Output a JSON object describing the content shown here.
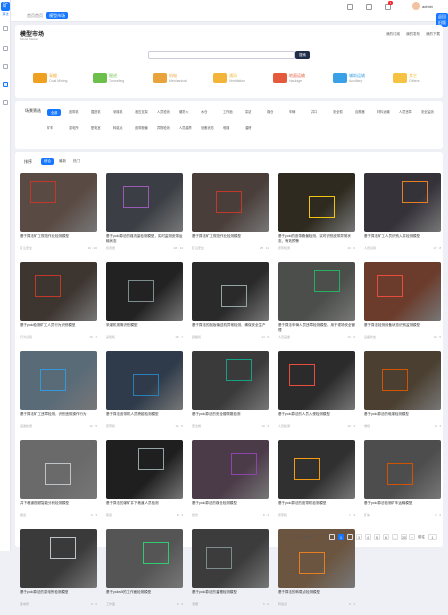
{
  "app": {
    "logo_char": "矿",
    "logo_text": "算法"
  },
  "top": {
    "breadcrumb_home": "首页首页",
    "breadcrumb_current": "模型市场",
    "badge_count": "1",
    "user_name": "admin",
    "mode_label": "返回旧版"
  },
  "page": {
    "title": "模型市场",
    "subtitle": "Model Market",
    "quick_links": [
      "我的订阅",
      "我的发布",
      "我的下载"
    ]
  },
  "search": {
    "placeholder": "",
    "button": "搜索"
  },
  "categories": [
    {
      "name": "采掘",
      "en": "Coal Mining",
      "color": "#f0a020"
    },
    {
      "name": "掘进",
      "en": "Tunneling",
      "color": "#6dbf4b"
    },
    {
      "name": "机电",
      "en": "Mechanical",
      "color": "#e8a33c"
    },
    {
      "name": "通风",
      "en": "Ventilation",
      "color": "#f2b53a"
    },
    {
      "name": "地面运输",
      "en": "Haulage",
      "color": "#e55a3c"
    },
    {
      "name": "辅助运输",
      "en": "Auxiliary",
      "color": "#3aa0e8"
    },
    {
      "name": "其它",
      "en": "Others",
      "color": "#f5c242"
    }
  ],
  "tags": {
    "label": "场景筛选",
    "items": [
      "全部",
      "皮带机",
      "掘进机",
      "采煤机",
      "液压支架",
      "人员检测",
      "烟雾火",
      "水仓",
      "工作面",
      "泵站",
      "煤仓",
      "车辆",
      "井口",
      "安全帽",
      "自救器",
      "材料运输",
      "人员违章",
      "安全监测",
      "矿车",
      "变电所",
      "配电室",
      "转载点",
      "皮带跑偏",
      "异物检测",
      "人员越界",
      "设备状态",
      "堆煤",
      "溜槽"
    ]
  },
  "sort": {
    "label": "排序",
    "items": [
      "综合",
      "最新",
      "热门"
    ]
  },
  "models": [
    {
      "caption": "基于算法矿工规范作业检测模型",
      "meta_l": "矿山安全",
      "meta_r": "32 · 20"
    },
    {
      "caption": "基于yolo算法的煤流量检测模型，实时监测皮带运输状态",
      "meta_l": "煤流量",
      "meta_r": "28 · 14"
    },
    {
      "caption": "基于算法矿工规范作业检测模型",
      "meta_l": "矿山安全",
      "meta_r": "25 · 11"
    },
    {
      "caption": "基于yolo的皮带跑偏检测，实时识别皮带异常状态，有效预警",
      "meta_l": "皮带检测",
      "meta_r": "19 · 9"
    },
    {
      "caption": "基于算法矿工人员识别入井检测模型",
      "meta_l": "人员识别",
      "meta_r": "17 · 8"
    },
    {
      "caption": "基于yolo检测矿工人员行为识别模型",
      "meta_l": "行为识别",
      "meta_r": "16 · 7"
    },
    {
      "caption": "采煤机滚筒识别模型",
      "meta_l": "采煤机",
      "meta_r": "15 · 7"
    },
    {
      "caption": "基于算法的刮板输送机异常检测，确保安全生产",
      "meta_l": "刮板机",
      "meta_r": "14 · 6"
    },
    {
      "caption": "基于算法车辆人员违章检测模型，用于现场安全管理",
      "meta_l": "人员违章",
      "meta_r": "13 · 6"
    },
    {
      "caption": "基于算法检测设备状态识别监测模型",
      "meta_l": "设备状态",
      "meta_r": "12 · 5"
    },
    {
      "caption": "基于算法矿工违章检测，识别违规操作行为",
      "meta_l": "违章检测",
      "meta_r": "12 · 5"
    },
    {
      "caption": "基于算法皮带机人员跨越检测模型",
      "meta_l": "皮带机",
      "meta_r": "11 · 5"
    },
    {
      "caption": "基于yolo算法的安全帽佩戴检测",
      "meta_l": "安全帽",
      "meta_r": "10 · 4"
    },
    {
      "caption": "基于yolo算法的人员入侵检测模型",
      "meta_l": "人员检测",
      "meta_r": "10 · 4"
    },
    {
      "caption": "基于yolo算法的堆煤检测模型",
      "meta_l": "堆煤",
      "meta_r": "9 · 4"
    },
    {
      "caption": "井下巷道视频智能分析检测模型",
      "meta_l": "巷道",
      "meta_r": "9 · 3"
    },
    {
      "caption": "基于算法的煤矿井下巷道人员检测",
      "meta_l": "巷道",
      "meta_r": "8 · 3"
    },
    {
      "caption": "基于yolo算法的煤仓检测模型",
      "meta_l": "煤仓",
      "meta_r": "8 · 3"
    },
    {
      "caption": "基于yolo算法的皮带机检测模型",
      "meta_l": "皮带机",
      "meta_r": "7 · 3"
    },
    {
      "caption": "基于yolo算法检测矿车运输模型",
      "meta_l": "矿车",
      "meta_r": "7 · 2"
    },
    {
      "caption": "基于yolo算法的变电所检测模型",
      "meta_l": "变电所",
      "meta_r": "6 · 2"
    },
    {
      "caption": "基于yolov5的工作面检测模型",
      "meta_l": "工作面",
      "meta_r": "6 · 2"
    },
    {
      "caption": "基于yolo算法的溜槽检测模型",
      "meta_l": "溜槽",
      "meta_r": "5 · 2"
    },
    {
      "caption": "基于算法的转载点检测模型",
      "meta_l": "转载点",
      "meta_r": "5 · 1"
    }
  ],
  "pagination": {
    "total": "共 120 条",
    "pages": [
      "1",
      "2",
      "3",
      "4",
      "5",
      "6",
      "…",
      "20"
    ],
    "next": "›",
    "prev": "‹",
    "jump": "前往",
    "jump_val": "1",
    "page_unit": "页"
  }
}
